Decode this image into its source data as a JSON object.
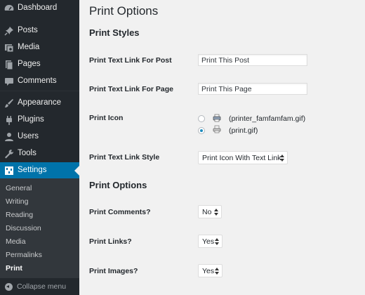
{
  "sidebar": {
    "items": [
      {
        "label": "Dashboard",
        "icon": "dashboard-icon"
      },
      {
        "label": "Posts",
        "icon": "pin-icon"
      },
      {
        "label": "Media",
        "icon": "media-icon"
      },
      {
        "label": "Pages",
        "icon": "pages-icon"
      },
      {
        "label": "Comments",
        "icon": "comments-icon"
      },
      {
        "label": "Appearance",
        "icon": "brush-icon"
      },
      {
        "label": "Plugins",
        "icon": "plugin-icon"
      },
      {
        "label": "Users",
        "icon": "users-icon"
      },
      {
        "label": "Tools",
        "icon": "wrench-icon"
      },
      {
        "label": "Settings",
        "icon": "settings-icon",
        "active": true
      }
    ],
    "submenu": [
      {
        "label": "General"
      },
      {
        "label": "Writing"
      },
      {
        "label": "Reading"
      },
      {
        "label": "Discussion"
      },
      {
        "label": "Media"
      },
      {
        "label": "Permalinks"
      },
      {
        "label": "Print",
        "current": true
      }
    ],
    "collapse_label": "Collapse menu"
  },
  "main": {
    "title": "Print Options",
    "sections": [
      {
        "heading": "Print Styles"
      },
      {
        "heading": "Print Options"
      }
    ],
    "fields": {
      "post_link": {
        "label": "Print Text Link For Post",
        "value": "Print This Post"
      },
      "page_link": {
        "label": "Print Text Link For Page",
        "value": "Print This Page"
      },
      "print_icon": {
        "label": "Print Icon",
        "options": [
          {
            "label": "(printer_famfamfam.gif)",
            "checked": false,
            "icon": "printer-icon"
          },
          {
            "label": "(print.gif)",
            "checked": true,
            "icon": "print-gif-icon"
          }
        ]
      },
      "link_style": {
        "label": "Print Text Link Style",
        "value": "Print Icon With Text Link"
      },
      "comments": {
        "label": "Print Comments?",
        "value": "No"
      },
      "links": {
        "label": "Print Links?",
        "value": "Yes"
      },
      "images": {
        "label": "Print Images?",
        "value": "Yes"
      }
    }
  },
  "colors": {
    "sidebar_bg": "#23282d",
    "submenu_bg": "#32373c",
    "accent": "#0073aa",
    "page_bg": "#f1f1f1"
  }
}
